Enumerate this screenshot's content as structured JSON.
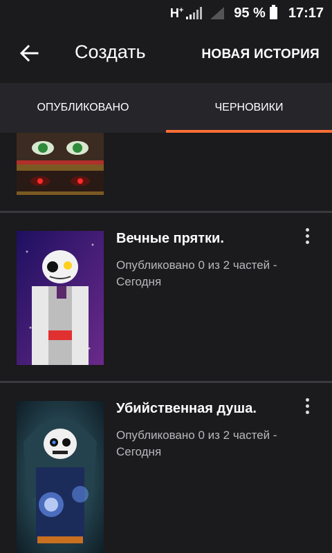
{
  "status_bar": {
    "network": "H",
    "network_sup": "+",
    "battery": "95 %",
    "time": "17:17"
  },
  "app_bar": {
    "back_icon": "arrow-left-icon",
    "title": "Создать",
    "action_label": "НОВАЯ ИСТОРИЯ"
  },
  "tabs": [
    {
      "label": "ОПУБЛИКОВАНО",
      "active": false
    },
    {
      "label": "ЧЕРНОВИКИ",
      "active": true
    }
  ],
  "colors": {
    "accent": "#ff6f36",
    "background": "#1b1a1c",
    "tab_bar": "#26252a"
  },
  "stories": [
    {
      "title": "Вечные прятки.",
      "meta": "Опубликовано 0 из 2 частей - Сегодня"
    },
    {
      "title": "Убийственная душа.",
      "meta": "Опубликовано 0 из 2 частей - Сегодня"
    }
  ]
}
